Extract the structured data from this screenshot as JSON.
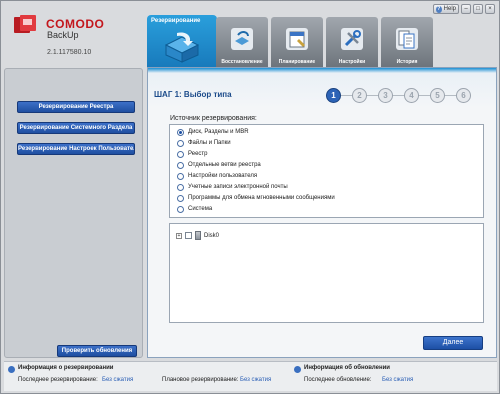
{
  "window_controls": {
    "help": "Help"
  },
  "logo": {
    "brand": "COMODO",
    "product": "BackUp",
    "version": "2.1.117580.10"
  },
  "sidebar": {
    "items": [
      {
        "label": "Резервирование Реестра"
      },
      {
        "label": "Резервирование Системного Раздела"
      },
      {
        "label": "Резервирование Настроек Пользователя"
      }
    ],
    "check_updates": "Проверить обновления"
  },
  "tabs": [
    {
      "label": "Резервирование"
    },
    {
      "label": "Восстановление"
    },
    {
      "label": "Планирование"
    },
    {
      "label": "Настройки"
    },
    {
      "label": "История"
    }
  ],
  "wizard": {
    "step_title": "ШАГ 1: Выбор типа",
    "steps": [
      "1",
      "2",
      "3",
      "4",
      "5",
      "6"
    ],
    "active_step": 1,
    "source_label": "Источник резервирования:",
    "options": [
      {
        "label": "Диск, Разделы и MBR",
        "selected": true
      },
      {
        "label": "Файлы и Папки",
        "selected": false
      },
      {
        "label": "Реестр",
        "selected": false
      },
      {
        "label": "Отдельные ветви реестра",
        "selected": false
      },
      {
        "label": "Настройки пользователя",
        "selected": false
      },
      {
        "label": "Учетные записи электронной почты",
        "selected": false
      },
      {
        "label": "Программы для обмена мгновенными сообщениями",
        "selected": false
      },
      {
        "label": "Система",
        "selected": false
      }
    ],
    "tree": {
      "disk_label": "Disk0"
    },
    "next_button": "Далее"
  },
  "footer": {
    "backup_info_title": "Информация о резервировании",
    "last_backup_label": "Последнее резервирование:",
    "last_backup_value": "Без сжатия",
    "planned_label": "Плановое резервирование:",
    "planned_value": "Без сжатия",
    "update_info_title": "Информация об обновлении",
    "last_update_label": "Последнее обновление:",
    "last_update_value": "Без сжатия"
  },
  "colors": {
    "accent": "#1f4fa1",
    "brand": "#c3161c",
    "tab_active": "#1a8fd4"
  }
}
